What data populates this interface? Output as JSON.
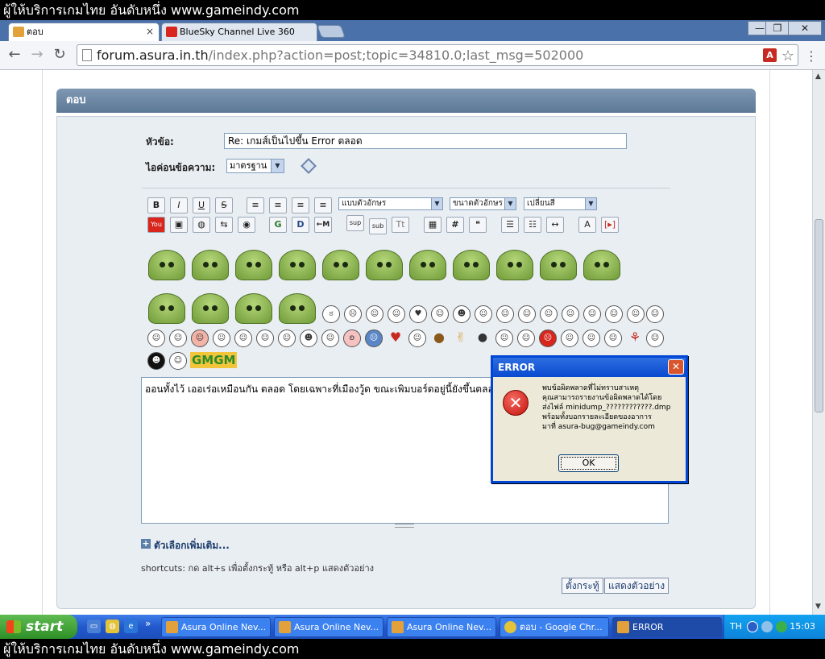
{
  "banner": {
    "text": "ผู้ให้บริการเกมไทย อันดับหนึ่ง www.gameindy.com"
  },
  "browser": {
    "tabs": [
      {
        "label": "ตอบ",
        "close": "×"
      },
      {
        "label": "BlueSky Channel Live 360",
        "close": ""
      }
    ],
    "url_host": "forum.asura.in.th",
    "url_path": "/index.php?action=post;topic=34810.0;last_msg=502000",
    "window_buttons": [
      "—",
      "❐",
      "✕"
    ],
    "colors": {
      "tabstrip": "#4b71ab",
      "pdf": "#c62a20"
    }
  },
  "forum": {
    "section_title": "ตอบ",
    "subject_label": "หัวข้อ:",
    "subject_value": "Re: เกมส์เป็นไปขึ้น Error ตลอด",
    "icon_label": "ไอค่อนข้อความ:",
    "icon_value": "มาตรฐาน",
    "toolbar": {
      "bold": "B",
      "italic": "I",
      "underline": "U",
      "strike": "S",
      "font_face": "แบบตัวอักษร",
      "font_size": "ขนาดตัวอักษร",
      "font_color": "เปลี่ยนสี",
      "glow": "G",
      "shadow": "D",
      "move": "←M",
      "sup": "sup",
      "sub": "sub",
      "tt": "Tt",
      "table": "▦",
      "code": "#",
      "quote": "❝"
    },
    "message": "ออนทั้งไว้ เออเร่อเหมือนกัน ตลอด โดยเฉพาะที่เมืองวู้ด ขณะเพิมบอร์ดอยู่นี้ยังขึ้นตลอด",
    "more_options": "ตัวเลือกเพิ่มเติม...",
    "shortcuts": "shortcuts: กด alt+s เพื่อตั้งกระทู้ หรือ alt+p แสดงตัวอย่าง",
    "post_button": "ตั้งกระทู้",
    "preview_button": "แสดงตัวอย่าง",
    "smiley_extra": "GMGM"
  },
  "dialog": {
    "title": "ERROR",
    "close": "✕",
    "icon": "✕",
    "lines": [
      "พบข้อผิดพลาดที่ไม่ทราบสาเหตุ",
      "คุณสามารถรายงานข้อผิดพลาดได้โดย",
      "ส่งไฟล์ minidump_????????????.dmp",
      "พร้อมทั้งบอกรายละเอียดของอาการ",
      "มาที่ asura-bug@gameindy.com"
    ],
    "ok": "OK"
  },
  "taskbar": {
    "start": "start",
    "tasks": [
      "Asura Online Nev...",
      "Asura Online Nev...",
      "Asura Online Nev...",
      "ตอบ - Google Chr...",
      "ERROR"
    ],
    "lang": "TH",
    "clock": "15:03",
    "overflow": "»"
  }
}
